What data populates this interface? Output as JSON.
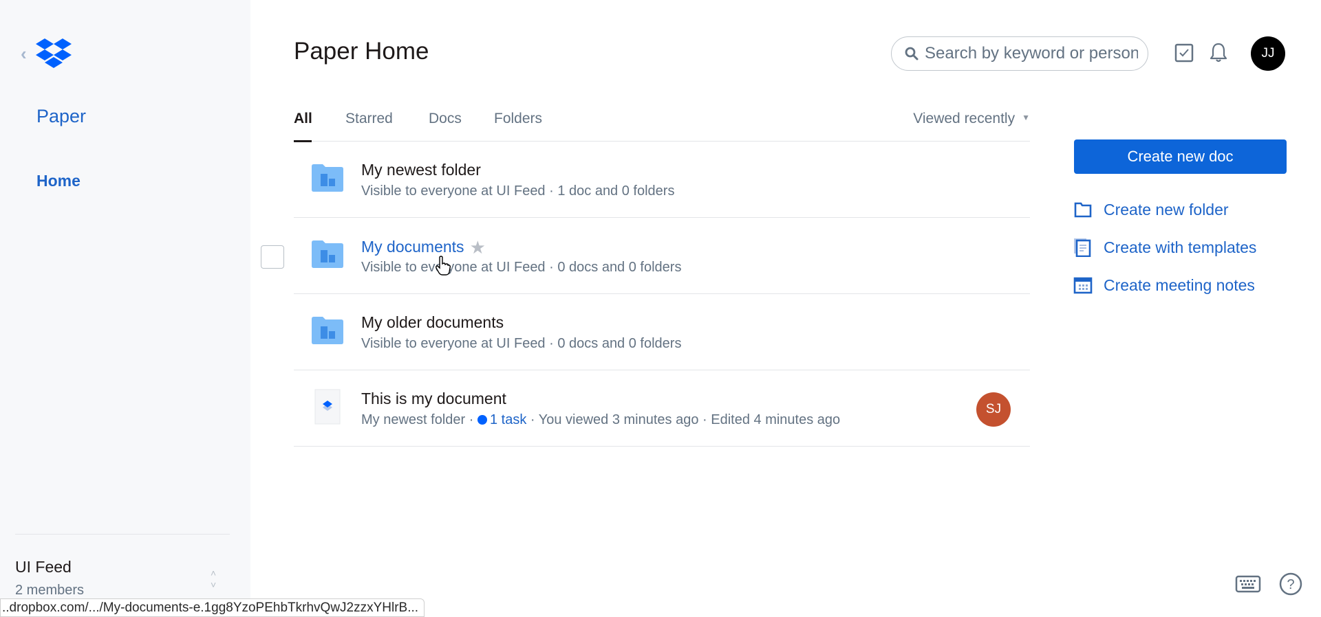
{
  "sidebar": {
    "back_icon": "chevron-left-icon",
    "logo_icon": "dropbox-logo-icon",
    "app_name": "Paper",
    "nav": [
      {
        "label": "Home",
        "active": true
      }
    ],
    "team": {
      "name": "UI Feed",
      "members": "2 members",
      "switch_icon": "chevron-updown-icon"
    }
  },
  "header": {
    "title": "Paper Home",
    "search": {
      "placeholder": "Search by keyword or person",
      "value": ""
    },
    "icons": [
      "tasks-checkbox-icon",
      "notifications-bell-icon"
    ],
    "user_avatar": {
      "initials": "JJ",
      "color": "#000000"
    }
  },
  "tabs": [
    {
      "label": "All",
      "active": true
    },
    {
      "label": "Starred",
      "active": false
    },
    {
      "label": "Docs",
      "active": false
    },
    {
      "label": "Folders",
      "active": false
    }
  ],
  "sort": {
    "selected": "Viewed recently"
  },
  "items": [
    {
      "type": "folder",
      "title": "My newest folder",
      "meta": "Visible to everyone at UI Feed · 1 doc and 0 folders"
    },
    {
      "type": "folder",
      "title": "My documents",
      "meta": "Visible to everyone at UI Feed · 0 docs and 0 folders",
      "hovered": true
    },
    {
      "type": "folder",
      "title": "My older documents",
      "meta": "Visible to everyone at UI Feed · 0 docs and 0 folders"
    },
    {
      "type": "doc",
      "title": "This is my document",
      "folder": "My newest folder",
      "sep": " · ",
      "task": "1 task",
      "viewed": " · You viewed 3 minutes ago · Edited 4 minutes ago",
      "avatar": {
        "initials": "SJ",
        "color": "#c4512f"
      }
    }
  ],
  "actions": {
    "create_doc": "Create new doc",
    "links": [
      {
        "label": "Create new folder",
        "icon": "folder-icon"
      },
      {
        "label": "Create with templates",
        "icon": "templates-icon"
      },
      {
        "label": "Create meeting notes",
        "icon": "calendar-icon"
      }
    ]
  },
  "footer": {
    "icons": [
      "keyboard-shortcuts-icon",
      "help-icon"
    ]
  },
  "status_bar": {
    "url": "..dropbox.com/.../My-documents-e.1gg8YzoPEhbTkrhvQwJ2zzxYHlrB..."
  },
  "colors": {
    "accent": "#1e64c8",
    "primary_button": "#0d65d9",
    "folder": "#7cbcf8"
  }
}
